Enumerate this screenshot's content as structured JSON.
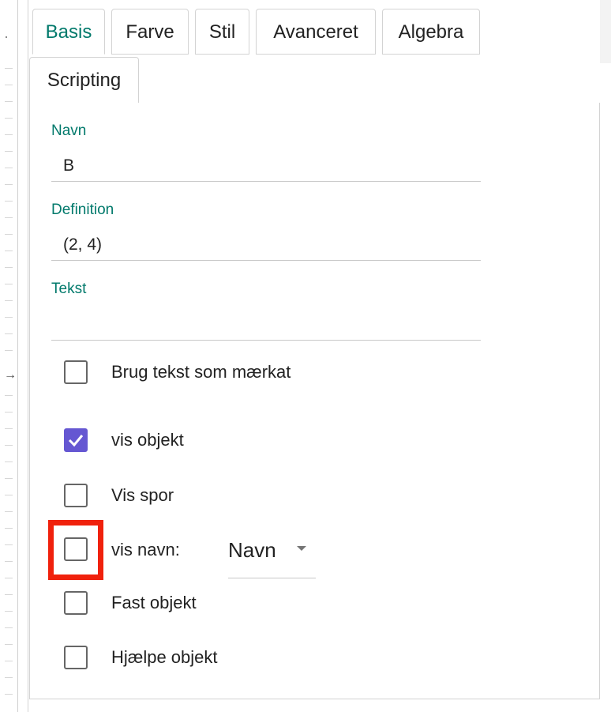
{
  "tabs": [
    {
      "label": "Basis",
      "active": true
    },
    {
      "label": "Farve",
      "active": false
    },
    {
      "label": "Stil",
      "active": false
    },
    {
      "label": "Avanceret",
      "active": false
    },
    {
      "label": "Algebra",
      "active": false
    },
    {
      "label": "Scripting",
      "active": false
    }
  ],
  "fields": {
    "name": {
      "label": "Navn",
      "value": "B"
    },
    "definition": {
      "label": "Definition",
      "value": "(2, 4)"
    },
    "caption": {
      "label": "Tekst",
      "value": ""
    }
  },
  "checkboxes": {
    "use_caption": {
      "label": "Brug tekst som mærkat",
      "checked": false
    },
    "show_object": {
      "label": "vis objekt",
      "checked": true
    },
    "show_trace": {
      "label": "Vis spor",
      "checked": false
    },
    "show_label": {
      "label": "vis navn:",
      "checked": false
    },
    "fix_object": {
      "label": "Fast objekt",
      "checked": false
    },
    "auxiliary": {
      "label": "Hjælpe objekt",
      "checked": false
    }
  },
  "label_select": {
    "value": "Navn"
  },
  "ruler": {
    "arrow_icon": "right-arrow-icon"
  },
  "colors": {
    "accent": "#00796b",
    "checkbox_checked": "#6557d2",
    "highlight": "#f0210c"
  }
}
